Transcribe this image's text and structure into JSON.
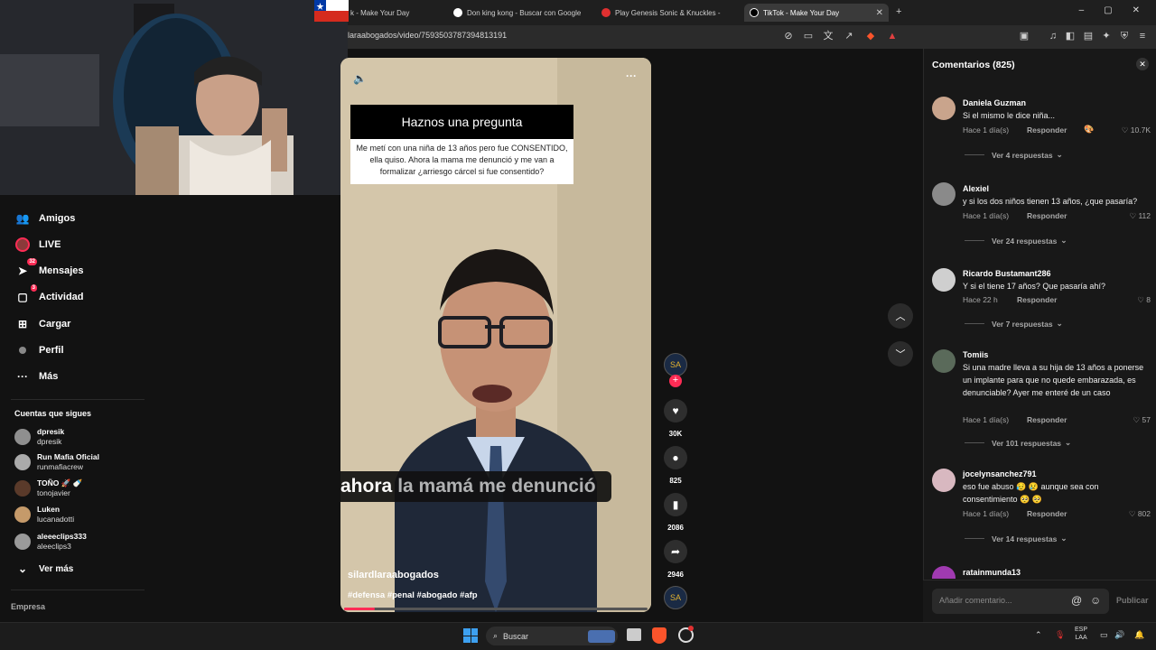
{
  "browser": {
    "tabs": [
      {
        "label": "k - Make Your Day",
        "favicon_color": "#ffffff"
      },
      {
        "label": "Don king kong - Buscar con Google",
        "favicon_color": "#ffffff"
      },
      {
        "label": "Play Genesis Sonic & Knuckles -",
        "favicon_color": "#e03030"
      },
      {
        "label": "TikTok - Make Your Day",
        "favicon_color": "#000000"
      }
    ],
    "new_tab": "+",
    "url": "laraabogados/video/7593503787394813191",
    "window_controls": [
      "–",
      "▢",
      "✕"
    ]
  },
  "left_nav": {
    "items": [
      {
        "label": "Amigos",
        "icon": "friends-icon"
      },
      {
        "label": "LIVE",
        "icon": "live-icon"
      },
      {
        "label": "Mensajes",
        "icon": "messages-icon",
        "badge": "32"
      },
      {
        "label": "Actividad",
        "icon": "activity-icon",
        "badge": "3"
      },
      {
        "label": "Cargar",
        "icon": "upload-icon"
      },
      {
        "label": "Perfil",
        "icon": "profile-icon"
      },
      {
        "label": "Más",
        "icon": "more-icon"
      }
    ],
    "following_title": "Cuentas que sigues",
    "accounts": [
      {
        "name": "dpresik",
        "handle": "dpresik"
      },
      {
        "name": "Run Mafia Oficial",
        "handle": "runmafiacrew"
      },
      {
        "name": "TOÑO 🚀 🍼",
        "handle": "tonojavier"
      },
      {
        "name": "Luken",
        "handle": "lucanadotti"
      },
      {
        "name": "aleeeclips333",
        "handle": "aleeclips3"
      }
    ],
    "see_more": "Ver más",
    "company": "Empresa"
  },
  "video": {
    "question_title": "Haznos una pregunta",
    "question_body": "Me metí con una niña de 13 años pero fue CONSENTIDO, ella quiso. Ahora la mama me denunció y me van a formalizar ¿arriesgo cárcel si fue consentido?",
    "caption_word1": "ahora",
    "caption_rest": "la mamá me denunció",
    "author": "silardlaraabogados",
    "hashtags": "#defensa #penal #abogado #afp",
    "progress_fraction": 0.1
  },
  "rail": {
    "likes": "30K",
    "comments": "825",
    "saves": "2086",
    "shares": "2946"
  },
  "comments_panel": {
    "header": "Comentarios (825)",
    "comments": [
      {
        "user": "Daniela Guzman",
        "text": "Si el mismo le dice niña...",
        "time": "Hace 1 día(s)",
        "reply": "Responder",
        "likes": "10.7K",
        "more": "Ver 4 respuestas",
        "avatar_color": "#c9a48c"
      },
      {
        "user": "Alexiel",
        "text": "y si los dos niños tienen 13 años, ¿que pasaría?",
        "time": "Hace 1 día(s)",
        "reply": "Responder",
        "likes": "112",
        "more": "Ver 24 respuestas",
        "avatar_color": "#8a8a8a"
      },
      {
        "user": "Ricardo Bustamant286",
        "text": "Y si el tiene 17 años? Que pasaría ahí?",
        "time": "Hace 22 h",
        "reply": "Responder",
        "likes": "8",
        "more": "Ver 7 respuestas",
        "avatar_color": "#cfcfcf"
      },
      {
        "user": "Tomiis",
        "text": "Si una madre lleva a su hija de 13 años a ponerse un implante para que no quede embarazada, es denunciable? Ayer me enteré de un caso",
        "time": "Hace 1 día(s)",
        "reply": "Responder",
        "likes": "57",
        "more": "Ver 101 respuestas",
        "avatar_color": "#5a6a5a"
      },
      {
        "user": "jocelynsanchez791",
        "text": "eso fue abuso 😥 😢 aunque sea con consentimiento 🥺 🥺",
        "time": "Hace 1 día(s)",
        "reply": "Responder",
        "likes": "802",
        "more": "Ver 14 respuestas",
        "avatar_color": "#d8b8c0"
      },
      {
        "user": "ratainmunda13",
        "text": "",
        "time": "",
        "reply": "",
        "likes": "",
        "more": "",
        "avatar_color": "#a03ab0"
      }
    ],
    "input_placeholder": "Añadir comentario...",
    "post_label": "Publicar"
  },
  "taskbar": {
    "search_label": "Buscar",
    "lang_top": "ESP",
    "lang_bottom": "LAA"
  }
}
